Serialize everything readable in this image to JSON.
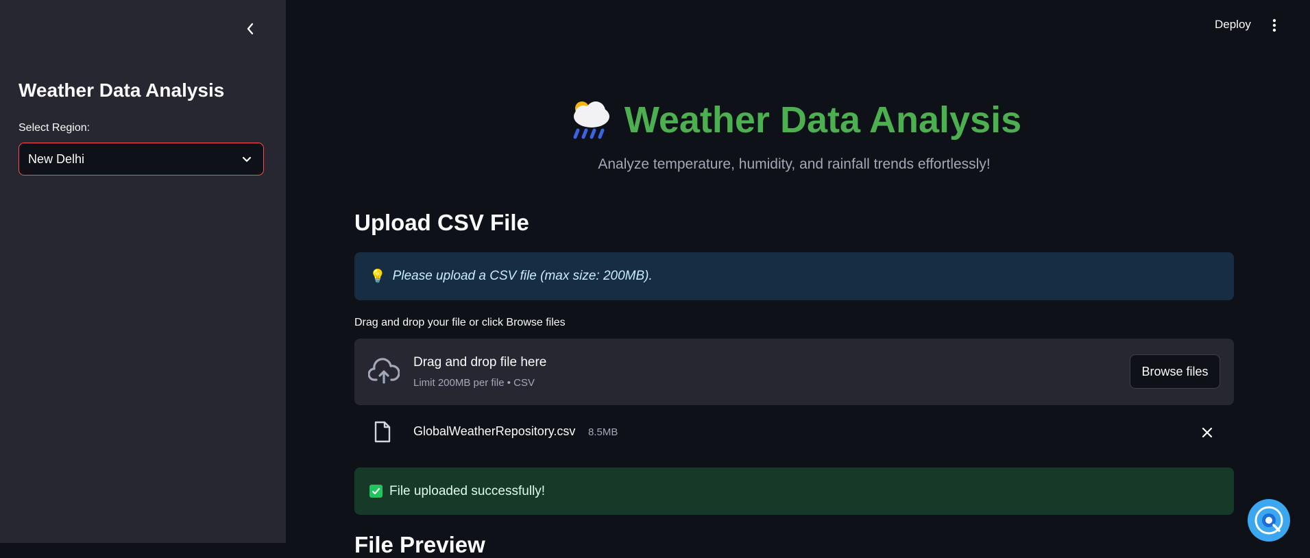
{
  "sidebar": {
    "title": "Weather Data Analysis",
    "region_label": "Select Region:",
    "region_selected": "New Delhi"
  },
  "header": {
    "deploy_label": "Deploy"
  },
  "main": {
    "title": "Weather Data Analysis",
    "subtitle": "Analyze temperature, humidity, and rainfall trends effortlessly!",
    "upload_section_title": "Upload CSV File",
    "info_icon": "💡",
    "info_text": "Please upload a CSV file (max size: 200MB).",
    "uploader_label": "Drag and drop your file or click Browse files",
    "dropzone_main": "Drag and drop file here",
    "dropzone_sub": "Limit 200MB per file • CSV",
    "browse_label": "Browse files",
    "uploaded_file": {
      "name": "GlobalWeatherRepository.csv",
      "size": "8.5MB"
    },
    "success_text": "File uploaded successfully!",
    "next_section_title": "File Preview"
  },
  "colors": {
    "accent": "#ff4b4b",
    "title_green": "#4caf50",
    "background": "#0e1117",
    "sidebar": "#262730"
  },
  "icons": [
    "chevron-left-icon",
    "chevron-down-icon",
    "kebab-menu-icon",
    "weather-emoji-icon",
    "lightbulb-icon",
    "cloud-upload-icon",
    "file-icon",
    "close-icon",
    "check-icon",
    "chat-assistant-icon"
  ]
}
